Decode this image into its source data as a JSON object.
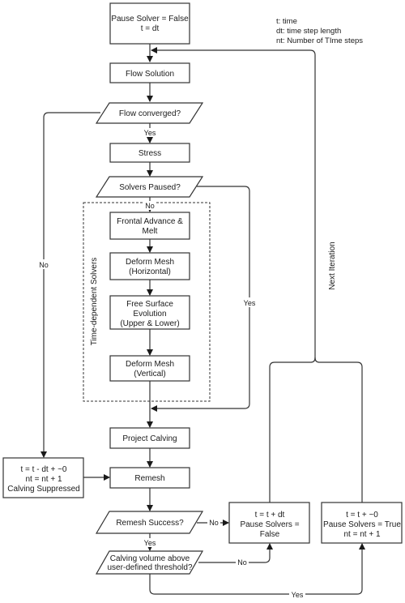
{
  "legend": {
    "lines": [
      "t: time",
      "dt: time step length",
      "nt: Number of TIme steps"
    ]
  },
  "nodes": {
    "init": {
      "shape": "process",
      "lines": [
        "Pause Solver = False",
        "t = dt"
      ]
    },
    "flow_solution": {
      "shape": "process",
      "lines": [
        "Flow Solution"
      ]
    },
    "flow_converged": {
      "shape": "decision",
      "lines": [
        "Flow converged?"
      ]
    },
    "stress": {
      "shape": "process",
      "lines": [
        "Stress"
      ]
    },
    "solvers_paused": {
      "shape": "decision",
      "lines": [
        "Solvers Paused?"
      ]
    },
    "frontal_advance": {
      "shape": "process",
      "lines": [
        "Frontal Advance &",
        "Melt"
      ]
    },
    "deform_mesh_h": {
      "shape": "process",
      "lines": [
        "Deform Mesh",
        "(Horizontal)"
      ]
    },
    "free_surface": {
      "shape": "process",
      "lines": [
        "Free Surface",
        "Evolution",
        "(Upper & Lower)"
      ]
    },
    "deform_mesh_v": {
      "shape": "process",
      "lines": [
        "Deform Mesh",
        "(Vertical)"
      ]
    },
    "project_calving": {
      "shape": "process",
      "lines": [
        "Project Calving"
      ]
    },
    "remesh": {
      "shape": "process",
      "lines": [
        "Remesh"
      ]
    },
    "calving_suppressed": {
      "shape": "process",
      "lines": [
        "t = t - dt + ~0",
        "nt = nt + 1",
        "Calving Suppressed"
      ]
    },
    "remesh_success": {
      "shape": "decision",
      "lines": [
        "Remesh Success?"
      ]
    },
    "calving_volume": {
      "shape": "decision",
      "lines": [
        "Calving volume above",
        "user-defined threshold?"
      ]
    },
    "advance_time": {
      "shape": "process",
      "lines": [
        "t = t + dt",
        "Pause Solvers =",
        "False"
      ]
    },
    "pause_solvers": {
      "shape": "process",
      "lines": [
        "t = t + ~0",
        "Pause Solvers = True",
        "nt = nt + 1"
      ]
    }
  },
  "group": {
    "label": "Time-dependent Solvers"
  },
  "edge_labels": {
    "flow_yes": "Yes",
    "flow_no": "No",
    "paused_no": "No",
    "paused_yes": "Yes",
    "remesh_no": "No",
    "remesh_yes": "Yes",
    "calving_no": "No",
    "calving_yes": "Yes",
    "next_iteration": "Next Iteration"
  }
}
